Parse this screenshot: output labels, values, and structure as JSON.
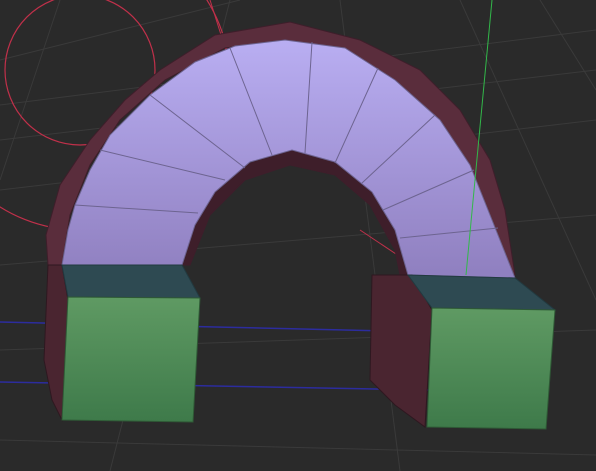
{
  "viewport": {
    "kind": "3d-viewport",
    "projection": "perspective",
    "grid_visible": true
  },
  "colors": {
    "background": "#2a2a2a",
    "grid_line": "#3a3a3a",
    "grid_line_major": "#333333",
    "axis_x": "#c0304a",
    "axis_y": "#32b84a",
    "axis_z": "#2c2c9e",
    "rotate_gizmo": "#c0304a",
    "arch_front_top": "#b9aef2",
    "arch_front_bottom": "#8f7fbf",
    "arch_edge_lines": "#6d6490",
    "arch_side": "#5a2d3c",
    "arch_side_dark": "#3e1e2a",
    "block_front_top": "#5f9a63",
    "block_front_bottom": "#3e7a4a",
    "block_top": "#2e4a52",
    "block_side": "#4a2530"
  },
  "objects": [
    {
      "name": "arch",
      "segments": 12,
      "selected": false
    },
    {
      "name": "left-pillar-block",
      "selected": false
    },
    {
      "name": "right-pillar-block",
      "selected": false
    }
  ]
}
